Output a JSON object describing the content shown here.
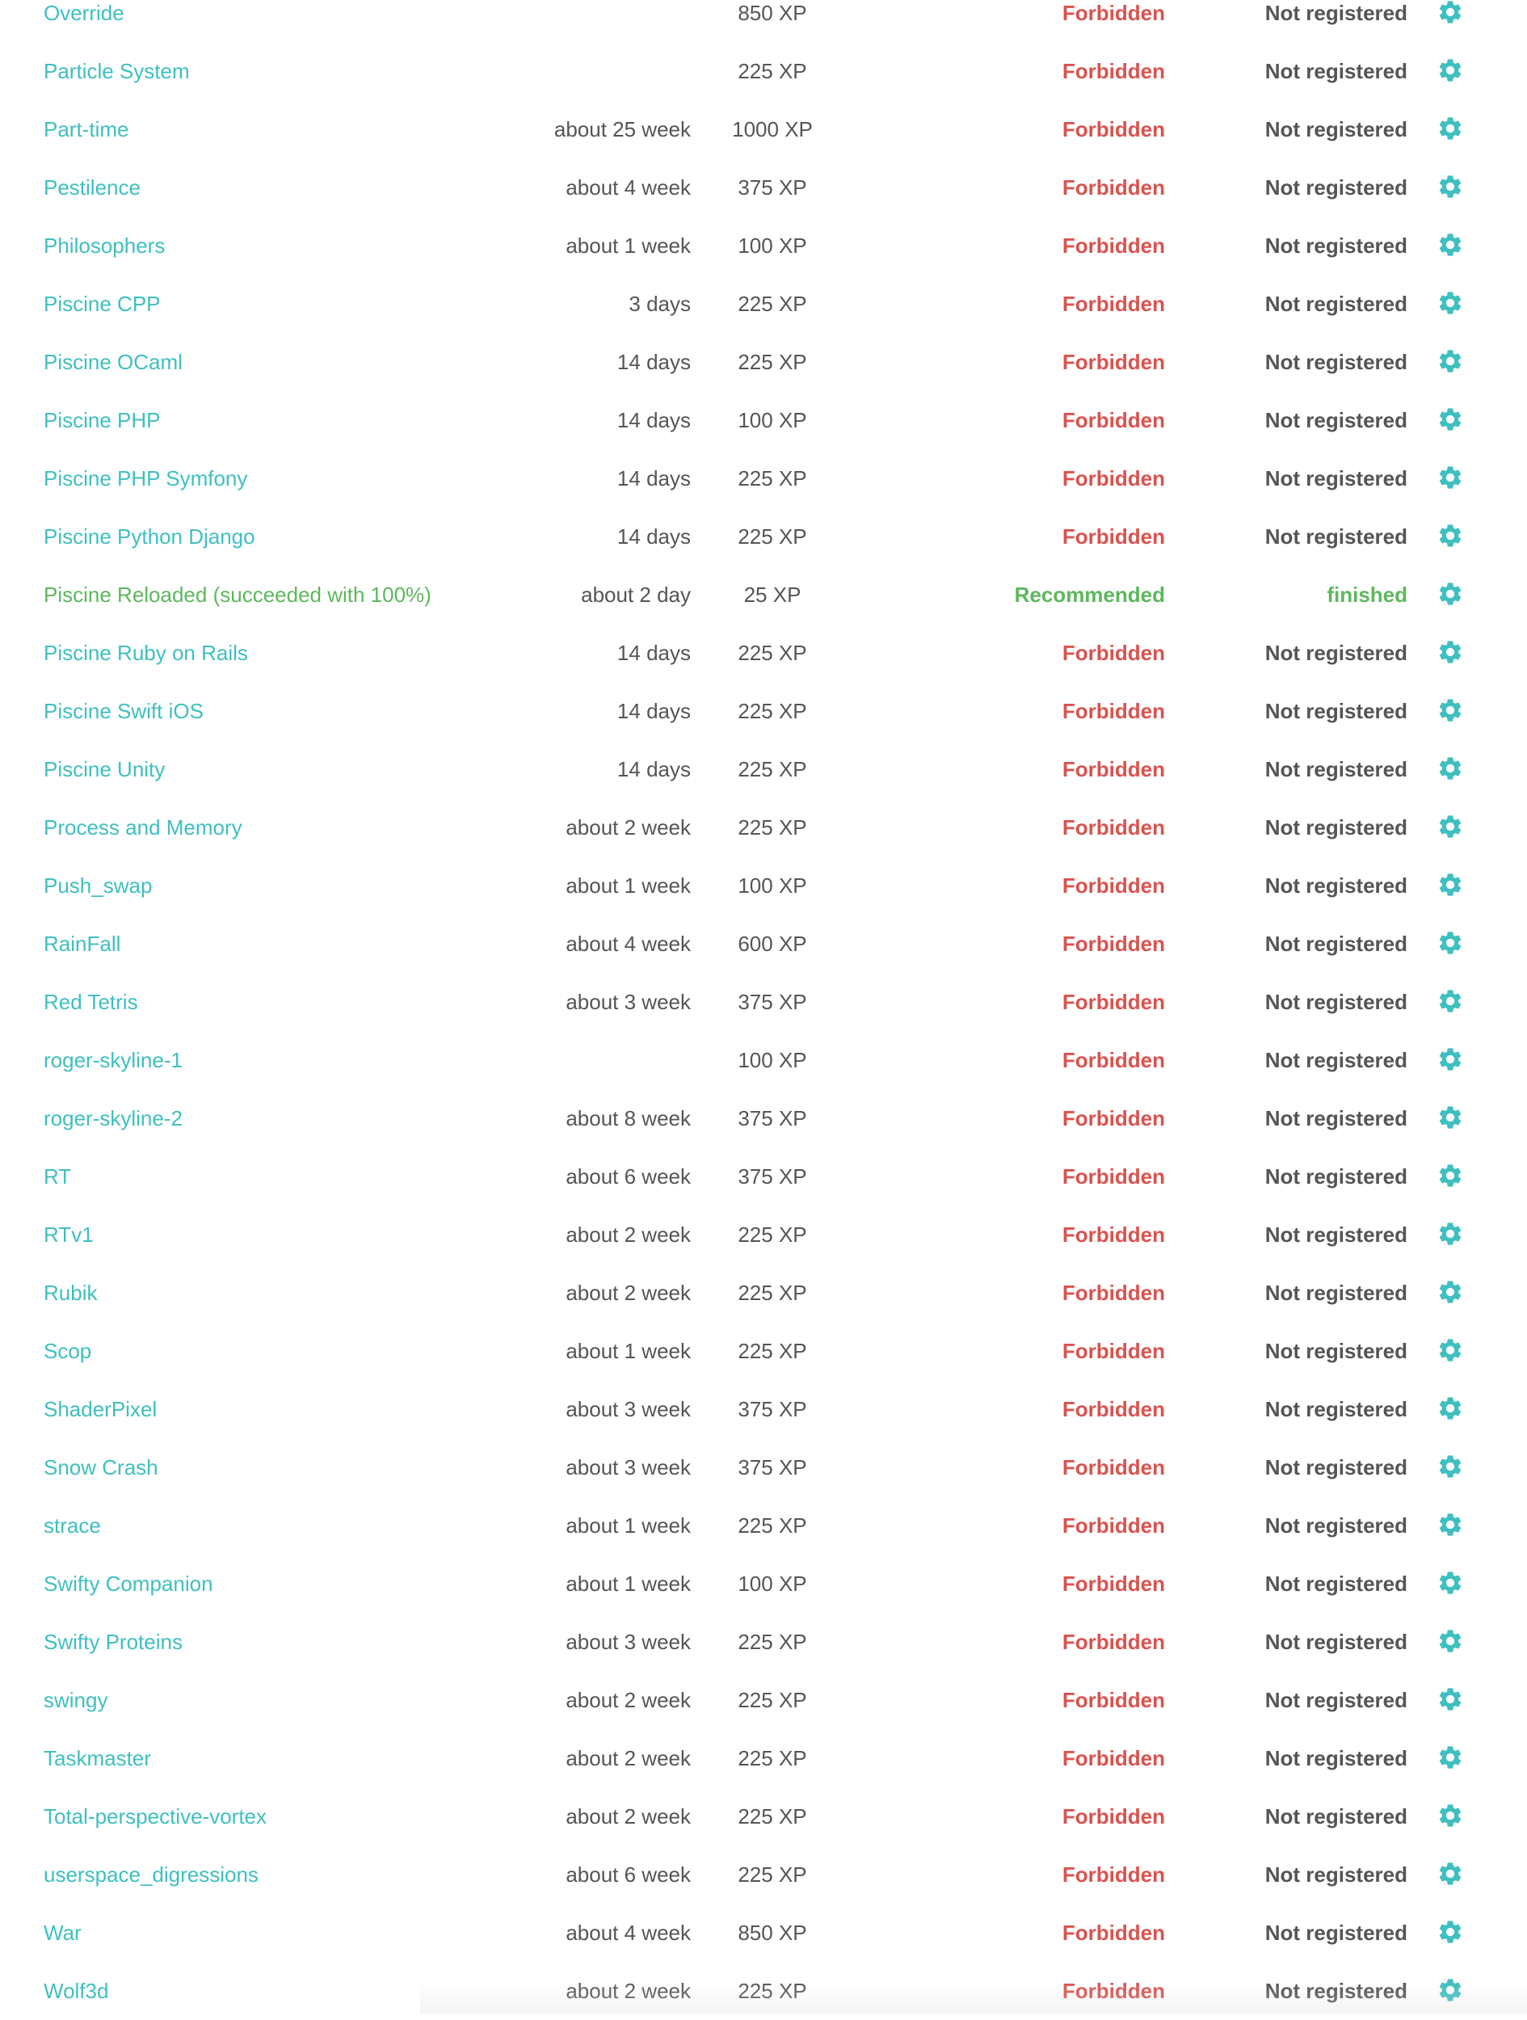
{
  "colors": {
    "link": "#3fbfc0",
    "success": "#5cb85c",
    "forbidden": "#d9534f",
    "muted": "#555555"
  },
  "icons": {
    "settings": "gear-icon"
  },
  "projects": [
    {
      "name": "Override",
      "duration": "",
      "xp": "850 XP",
      "access": "Forbidden",
      "status": "Not registered"
    },
    {
      "name": "Particle System",
      "duration": "",
      "xp": "225 XP",
      "access": "Forbidden",
      "status": "Not registered"
    },
    {
      "name": "Part-time",
      "duration": "about 25 week",
      "xp": "1000 XP",
      "access": "Forbidden",
      "status": "Not registered"
    },
    {
      "name": "Pestilence",
      "duration": "about 4 week",
      "xp": "375 XP",
      "access": "Forbidden",
      "status": "Not registered"
    },
    {
      "name": "Philosophers",
      "duration": "about 1 week",
      "xp": "100 XP",
      "access": "Forbidden",
      "status": "Not registered"
    },
    {
      "name": "Piscine CPP",
      "duration": "3 days",
      "xp": "225 XP",
      "access": "Forbidden",
      "status": "Not registered"
    },
    {
      "name": "Piscine OCaml",
      "duration": "14 days",
      "xp": "225 XP",
      "access": "Forbidden",
      "status": "Not registered"
    },
    {
      "name": "Piscine PHP",
      "duration": "14 days",
      "xp": "100 XP",
      "access": "Forbidden",
      "status": "Not registered"
    },
    {
      "name": "Piscine PHP Symfony",
      "duration": "14 days",
      "xp": "225 XP",
      "access": "Forbidden",
      "status": "Not registered"
    },
    {
      "name": "Piscine Python Django",
      "duration": "14 days",
      "xp": "225 XP",
      "access": "Forbidden",
      "status": "Not registered"
    },
    {
      "name": "Piscine Reloaded (succeeded with 100%)",
      "duration": "about 2 day",
      "xp": "25 XP",
      "access": "Recommended",
      "status": "finished",
      "state": "ok"
    },
    {
      "name": "Piscine Ruby on Rails",
      "duration": "14 days",
      "xp": "225 XP",
      "access": "Forbidden",
      "status": "Not registered"
    },
    {
      "name": "Piscine Swift iOS",
      "duration": "14 days",
      "xp": "225 XP",
      "access": "Forbidden",
      "status": "Not registered"
    },
    {
      "name": "Piscine Unity",
      "duration": "14 days",
      "xp": "225 XP",
      "access": "Forbidden",
      "status": "Not registered"
    },
    {
      "name": "Process and Memory",
      "duration": "about 2 week",
      "xp": "225 XP",
      "access": "Forbidden",
      "status": "Not registered"
    },
    {
      "name": "Push_swap",
      "duration": "about 1 week",
      "xp": "100 XP",
      "access": "Forbidden",
      "status": "Not registered"
    },
    {
      "name": "RainFall",
      "duration": "about 4 week",
      "xp": "600 XP",
      "access": "Forbidden",
      "status": "Not registered"
    },
    {
      "name": "Red Tetris",
      "duration": "about 3 week",
      "xp": "375 XP",
      "access": "Forbidden",
      "status": "Not registered"
    },
    {
      "name": "roger-skyline-1",
      "duration": "",
      "xp": "100 XP",
      "access": "Forbidden",
      "status": "Not registered"
    },
    {
      "name": "roger-skyline-2",
      "duration": "about 8 week",
      "xp": "375 XP",
      "access": "Forbidden",
      "status": "Not registered"
    },
    {
      "name": "RT",
      "duration": "about 6 week",
      "xp": "375 XP",
      "access": "Forbidden",
      "status": "Not registered"
    },
    {
      "name": "RTv1",
      "duration": "about 2 week",
      "xp": "225 XP",
      "access": "Forbidden",
      "status": "Not registered"
    },
    {
      "name": "Rubik",
      "duration": "about 2 week",
      "xp": "225 XP",
      "access": "Forbidden",
      "status": "Not registered"
    },
    {
      "name": "Scop",
      "duration": "about 1 week",
      "xp": "225 XP",
      "access": "Forbidden",
      "status": "Not registered"
    },
    {
      "name": "ShaderPixel",
      "duration": "about 3 week",
      "xp": "375 XP",
      "access": "Forbidden",
      "status": "Not registered"
    },
    {
      "name": "Snow Crash",
      "duration": "about 3 week",
      "xp": "375 XP",
      "access": "Forbidden",
      "status": "Not registered"
    },
    {
      "name": "strace",
      "duration": "about 1 week",
      "xp": "225 XP",
      "access": "Forbidden",
      "status": "Not registered"
    },
    {
      "name": "Swifty Companion",
      "duration": "about 1 week",
      "xp": "100 XP",
      "access": "Forbidden",
      "status": "Not registered"
    },
    {
      "name": "Swifty Proteins",
      "duration": "about 3 week",
      "xp": "225 XP",
      "access": "Forbidden",
      "status": "Not registered"
    },
    {
      "name": "swingy",
      "duration": "about 2 week",
      "xp": "225 XP",
      "access": "Forbidden",
      "status": "Not registered"
    },
    {
      "name": "Taskmaster",
      "duration": "about 2 week",
      "xp": "225 XP",
      "access": "Forbidden",
      "status": "Not registered"
    },
    {
      "name": "Total-perspective-vortex",
      "duration": "about 2 week",
      "xp": "225 XP",
      "access": "Forbidden",
      "status": "Not registered"
    },
    {
      "name": "userspace_digressions",
      "duration": "about 6 week",
      "xp": "225 XP",
      "access": "Forbidden",
      "status": "Not registered"
    },
    {
      "name": "War",
      "duration": "about 4 week",
      "xp": "850 XP",
      "access": "Forbidden",
      "status": "Not registered"
    },
    {
      "name": "Wolf3d",
      "duration": "about 2 week",
      "xp": "225 XP",
      "access": "Forbidden",
      "status": "Not registered"
    }
  ]
}
